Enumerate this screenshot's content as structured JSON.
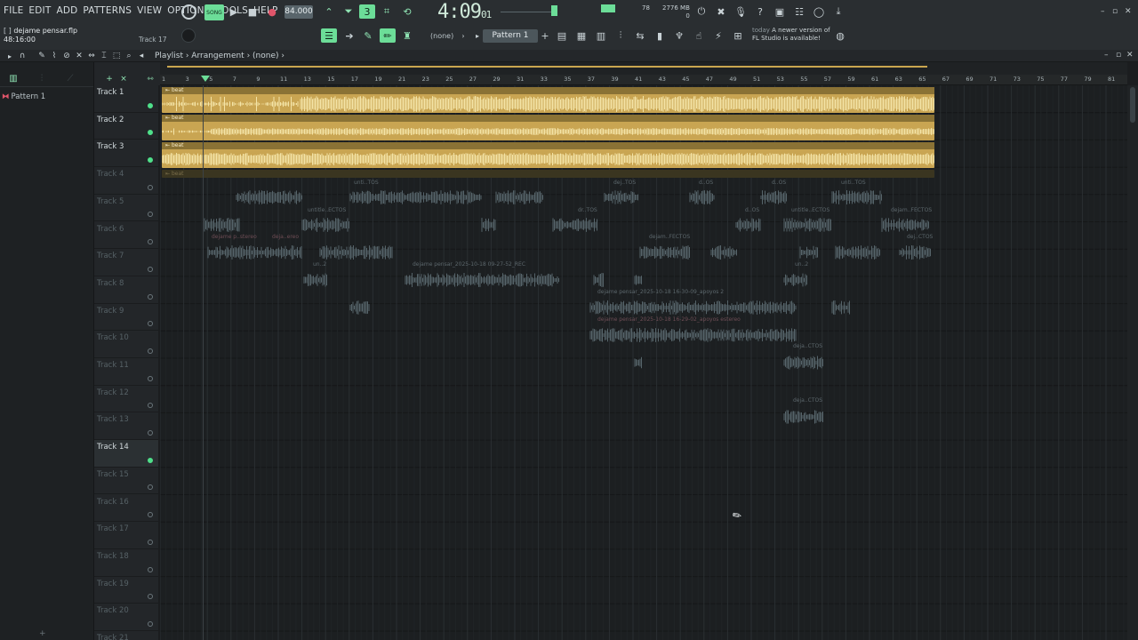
{
  "menu": [
    "FILE",
    "EDIT",
    "ADD",
    "PATTERNS",
    "VIEW",
    "OPTIONS",
    "TOOLS",
    "HELP"
  ],
  "file": {
    "brackets": "[  ]",
    "name": "dejame pensar.flp",
    "position": "48:16:00"
  },
  "current_track": "Track 17",
  "song_mode": "SONG",
  "tempo": "84.000",
  "time_display": {
    "main": "4:09",
    "sub": "01"
  },
  "cpu": "78",
  "memory": {
    "mb": "2776 MB",
    "value": "0"
  },
  "pattern_selector": "Pattern 1",
  "channel_selector": "(none)",
  "news": {
    "when": "today",
    "line1": "A newer version of",
    "line2": "FL Studio is available!"
  },
  "playlist_breadcrumb": "Playlist › Arrangement › (none) ›",
  "pattern_list": [
    "Pattern 1"
  ],
  "ruler_bars": [
    "1",
    "3",
    "5",
    "7",
    "9",
    "11",
    "13",
    "15",
    "17",
    "19",
    "21",
    "23",
    "25",
    "27",
    "29",
    "31",
    "33",
    "35",
    "37",
    "39",
    "41",
    "43",
    "45",
    "47",
    "49",
    "51",
    "53",
    "55",
    "57",
    "59",
    "61",
    "63",
    "65",
    "67",
    "69",
    "71",
    "73",
    "75",
    "77",
    "79",
    "81"
  ],
  "tracks": [
    {
      "name": "Track 1",
      "active": true
    },
    {
      "name": "Track 2",
      "active": true
    },
    {
      "name": "Track 3",
      "active": true
    },
    {
      "name": "Track 4",
      "active": false
    },
    {
      "name": "Track 5",
      "active": false
    },
    {
      "name": "Track 6",
      "active": false
    },
    {
      "name": "Track 7",
      "active": false
    },
    {
      "name": "Track 8",
      "active": false
    },
    {
      "name": "Track 9",
      "active": false
    },
    {
      "name": "Track 10",
      "active": false
    },
    {
      "name": "Track 11",
      "active": false
    },
    {
      "name": "Track 12",
      "active": false
    },
    {
      "name": "Track 13",
      "active": false
    },
    {
      "name": "Track 14",
      "active": true
    },
    {
      "name": "Track 15",
      "active": false
    },
    {
      "name": "Track 16",
      "active": false
    },
    {
      "name": "Track 17",
      "active": false
    },
    {
      "name": "Track 18",
      "active": false
    },
    {
      "name": "Track 19",
      "active": false
    },
    {
      "name": "Track 20",
      "active": false
    },
    {
      "name": "Track 21",
      "active": false
    }
  ],
  "clips": {
    "beat": "beat",
    "t5": [
      "unti..TOS",
      "dej..TOS",
      "d..OS",
      "d..OS",
      "unti..TOS"
    ],
    "t6": [
      "untitle..ECTOS",
      "dr..TOS",
      "d..OS",
      "untitle..ECTOS",
      "dejam..FECTOS"
    ],
    "t7": [
      "dejame p..stereo",
      "deja..ereo",
      "dejam..FECTOS",
      "dej..CTOS"
    ],
    "t8": [
      "un..2",
      "dejame pensar_2025-10-18 09-27-52_REC",
      "un..2"
    ],
    "t9": "dejame pensar_2025-10-18 16-30-09_apoyos 2",
    "t10": "dejame pensar_2025-10-18 16-29-02_apoyos estereo",
    "t11": "deja..CTOS",
    "t13": "deja..CTOS"
  },
  "colors": {
    "accent": "#6cdd98",
    "beat_clip": "#c9a552",
    "background": "#1c1f21"
  }
}
